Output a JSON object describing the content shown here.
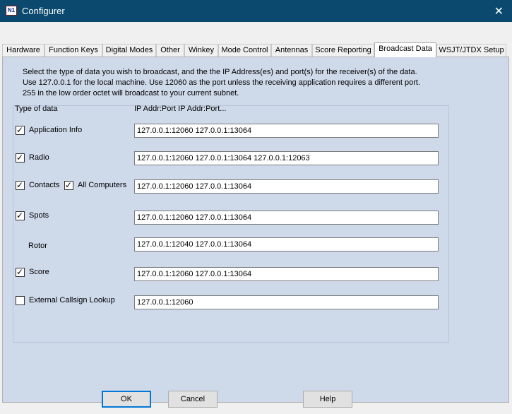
{
  "window": {
    "title": "Configurer",
    "icon": "n1mm-logo-icon",
    "icon_text": "N1"
  },
  "tabs": [
    {
      "label": "Hardware"
    },
    {
      "label": "Function Keys"
    },
    {
      "label": "Digital Modes"
    },
    {
      "label": "Other"
    },
    {
      "label": "Winkey"
    },
    {
      "label": "Mode Control"
    },
    {
      "label": "Antennas"
    },
    {
      "label": "Score Reporting"
    },
    {
      "label": "Broadcast Data",
      "active": true
    },
    {
      "label": "WSJT/JTDX Setup"
    }
  ],
  "instructions": [
    "Select the type of data you wish to broadcast, and the the IP Address(es) and port(s) for the receiver(s) of the data.",
    "Use 127.0.0.1 for the local machine.  Use 12060 as the port unless the receiving application requires a different port.",
    "255 in the low order octet will broadcast to your current subnet."
  ],
  "headers": {
    "type": "Type of data",
    "addr": "IP Addr:Port IP Addr:Port..."
  },
  "rows": [
    {
      "label": "Application Info",
      "checked": true,
      "value": "127.0.0.1:12060 127.0.0.1:13064"
    },
    {
      "label": "Radio",
      "checked": true,
      "value": "127.0.0.1:12060 127.0.0.1:13064 127.0.0.1:12063"
    },
    {
      "label": "Contacts",
      "checked": true,
      "extra_label": "All Computers",
      "extra_checked": true,
      "value": "127.0.0.1:12060 127.0.0.1:13064"
    },
    {
      "label": "Spots",
      "checked": true,
      "value": "127.0.0.1:12060 127.0.0.1:13064"
    },
    {
      "label": "Rotor",
      "value": "127.0.0.1:12040 127.0.0.1:13064"
    },
    {
      "label": "Score",
      "checked": true,
      "value": "127.0.0.1:12060 127.0.0.1:13064"
    },
    {
      "label": "External Callsign Lookup",
      "checked": false,
      "value": "127.0.0.1:12060"
    }
  ],
  "buttons": {
    "ok": "OK",
    "cancel": "Cancel",
    "help": "Help"
  },
  "colors": {
    "titlebar": "#0b4a6e",
    "panel": "#ced9ea",
    "default_button_border": "#0078d7"
  }
}
